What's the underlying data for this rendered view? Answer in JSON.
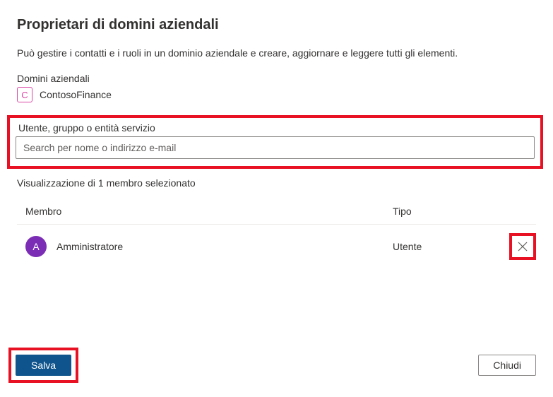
{
  "title": "Proprietari di domini aziendali",
  "description": "Può gestire i contatti e i ruoli in un dominio aziendale e creare, aggiornare e leggere tutti gli elementi.",
  "domain_section": {
    "label": "Domini aziendali",
    "badge_letter": "C",
    "name": "ContosoFinance"
  },
  "search": {
    "label": "Utente, gruppo o entità servizio",
    "placeholder": "Search per nome o indirizzo e-mail"
  },
  "members_caption": "Visualizzazione di 1 membro selezionato",
  "table": {
    "headers": {
      "member": "Membro",
      "type": "Tipo"
    },
    "rows": [
      {
        "avatar_letter": "A",
        "name": "Amministratore",
        "type": "Utente"
      }
    ]
  },
  "footer": {
    "save": "Salva",
    "close": "Chiudi"
  }
}
